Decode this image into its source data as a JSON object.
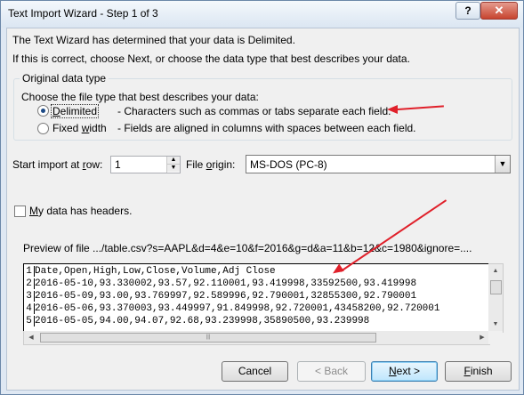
{
  "window": {
    "title": "Text Import Wizard - Step 1 of 3",
    "help_label": "?",
    "close_label": "✕"
  },
  "intro": {
    "line1": "The Text Wizard has determined that your data is Delimited.",
    "line2": "If this is correct, choose Next, or choose the data type that best describes your data."
  },
  "original_data_type": {
    "legend": "Original data type",
    "prompt": "Choose the file type that best describes your data:",
    "options": [
      {
        "prefix": "",
        "underline": "D",
        "suffix": "elimited",
        "description": "- Characters such as commas or tabs separate each field.",
        "selected": true
      },
      {
        "prefix": "Fixed ",
        "underline": "w",
        "suffix": "idth",
        "description": "- Fields are aligned in columns with spaces between each field.",
        "selected": false
      }
    ]
  },
  "start_row": {
    "label_prefix": "Start import at ",
    "label_underline": "r",
    "label_suffix": "ow:",
    "value": "1"
  },
  "file_origin": {
    "label_prefix": "File ",
    "label_underline": "o",
    "label_suffix": "rigin:",
    "value": "MS-DOS (PC-8)"
  },
  "headers_checkbox": {
    "label_prefix": "",
    "label_underline": "M",
    "label_suffix": "y data has headers.",
    "checked": false
  },
  "preview": {
    "label": "Preview of file .../table.csv?s=AAPL&d=4&e=10&f=2016&g=d&a=11&b=12&c=1980&ignore=....",
    "rows": [
      {
        "num": "1",
        "text": "Date,Open,High,Low,Close,Volume,Adj Close"
      },
      {
        "num": "2",
        "text": "2016-05-10,93.330002,93.57,92.110001,93.419998,33592500,93.419998"
      },
      {
        "num": "3",
        "text": "2016-05-09,93.00,93.769997,92.589996,92.790001,32855300,92.790001"
      },
      {
        "num": "4",
        "text": "2016-05-06,93.370003,93.449997,91.849998,92.720001,43458200,92.720001"
      },
      {
        "num": "5",
        "text": "2016-05-05,94.00,94.07,92.68,93.239998,35890500,93.239998"
      }
    ]
  },
  "buttons": {
    "cancel": "Cancel",
    "back": "< Back",
    "next_prefix": "",
    "next_underline": "N",
    "next_suffix": "ext >",
    "finish_prefix": "",
    "finish_underline": "F",
    "finish_suffix": "inish"
  },
  "icons": {
    "spin_up": "▲",
    "spin_down": "▼",
    "dropdown": "▼",
    "scroll_up": "▲",
    "scroll_down": "▼",
    "scroll_left": "◀",
    "scroll_right": "▶",
    "grip": "|||"
  },
  "colors": {
    "annotation_arrow": "#e0202a",
    "default_button_border": "#3c7fb1"
  }
}
